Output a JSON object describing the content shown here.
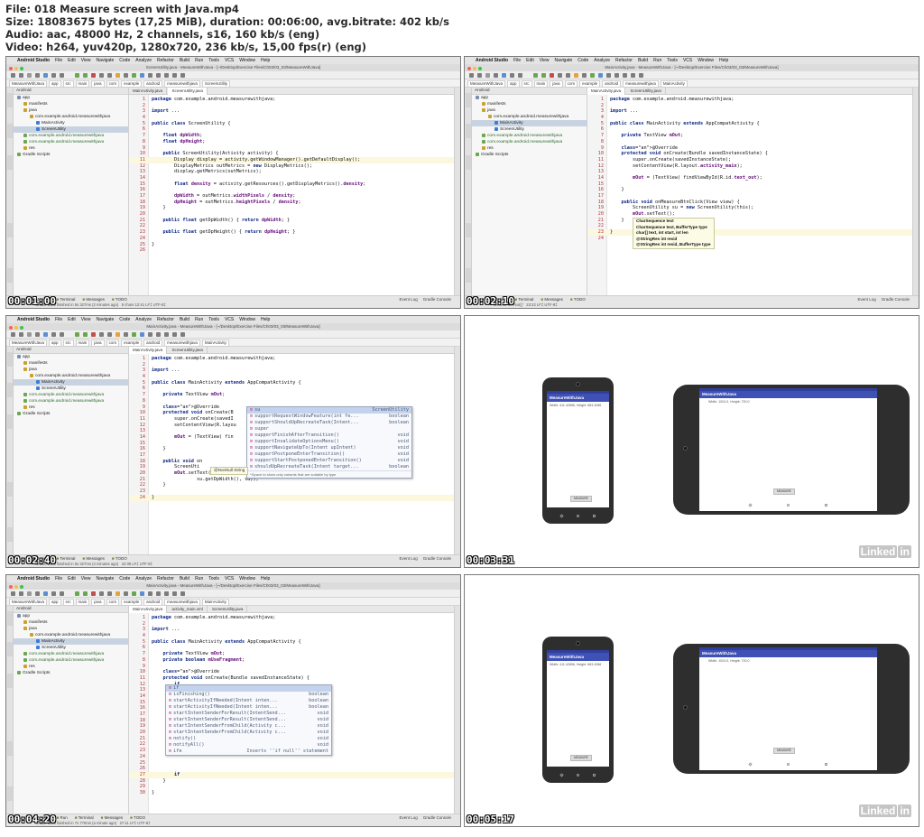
{
  "file_info": {
    "line1": "File: 018 Measure screen with Java.mp4",
    "line2": "Size: 18083675 bytes (17,25 MiB), duration: 00:06:00, avg.bitrate: 402 kb/s",
    "line3": "Audio: aac, 48000 Hz, 2 channels, s16, 160 kb/s (eng)",
    "line4": "Video: h264, yuv420p, 1280x720, 236 kb/s, 15,00 fps(r) (eng)"
  },
  "ide": {
    "app_name": "Android Studio",
    "menu": [
      "File",
      "Edit",
      "View",
      "Navigate",
      "Code",
      "Analyze",
      "Refactor",
      "Build",
      "Run",
      "Tools",
      "VCS",
      "Window",
      "Help"
    ],
    "project_label": "Android",
    "nav_crumbs": [
      "MeasureWithJava",
      "app",
      "src",
      "main",
      "java",
      "com",
      "example",
      "android",
      "measurewithjava"
    ],
    "tree": [
      "app",
      "manifests",
      "java",
      "com.example.android.measurewithjava",
      "MainActivity",
      "ScreenUtility",
      "com.example.android.measurewithjava",
      "com.example.android.measurewithjava",
      "res",
      "Gradle Scripts"
    ],
    "bottom_tools": [
      "Android Monitor",
      "Terminal",
      "Messages",
      "TODO"
    ],
    "bottom_tools_run": [
      "Android Monitor",
      "Run",
      "Terminal",
      "Messages",
      "TODO"
    ],
    "event_log": "Event Log",
    "gradle_console": "Gradle Console",
    "tab_main": "MainActivity.java",
    "tab_screen": "ScreenUtility.java",
    "tab_layout": "activity_main.xml"
  },
  "thumbs": [
    {
      "timestamp": "00:01:00",
      "title": "ScreenUtility.java - MeasureWithJava - [~/Desktop/Exercise Files/Ch03/03_03/MeasureWithJava]",
      "crumb": "ScreenUtility",
      "status": "8 chars   12:41  LF‡  UTF-8‡",
      "msg": "Gradle build finished in 5s 327ms (2 minutes ago)"
    },
    {
      "timestamp": "00:02:10",
      "title": "MainActivity.java - MeasureWithJava - [~/Desktop/Exercise Files/Ch03/03_03/MeasureWithJava]",
      "crumb": "MainActivity",
      "status": "23:22  LF‡  UTF-8‡",
      "msg": "Method 'setText()'"
    },
    {
      "timestamp": "00:02:40",
      "title": "MainActivity.java - MeasureWithJava - [~/Desktop/Exercise Files/Ch03/03_03/MeasureWithJava]",
      "crumb": "MainActivity",
      "status": "24:36  LF‡  UTF-8‡",
      "msg": "Gradle build finished in 5s 327ms (4 minutes ago)"
    },
    {
      "timestamp": "00:03:31"
    },
    {
      "timestamp": "00:04:20",
      "title": "MainActivity.java - MeasureWithJava - [~/Desktop/Exercise Files/Ch03/03_03/MeasureWithJava]",
      "crumb": "MainActivity",
      "status": "27:11  LF‡  UTF-8‡",
      "msg": "Gradle build finished in 7s 776ms (a minute ago)"
    },
    {
      "timestamp": "00:05:17"
    }
  ],
  "code1": [
    "package com.example.android.measurewithjava;",
    "",
    "import ...",
    "",
    "public class ScreenUtility {",
    "",
    "    float dpWidth;",
    "    float dpHeight;",
    "",
    "    public ScreenUtility(Activity activity) {",
    "        Display display = activity.getWindowManager().getDefaultDisplay();",
    "        DisplayMetrics outMetrics = new DisplayMetrics();",
    "        display.getMetrics(outMetrics);",
    "",
    "        float density = activity.getResources().getDisplayMetrics().density;",
    "",
    "        dpWidth = outMetrics.widthPixels / density;",
    "        dpHeight = outMetrics.heightPixels / density;",
    "    }",
    "",
    "    public float getDpWidth() { return dpWidth; }",
    "",
    "    public float getDpHeight() { return dpHeight; }",
    "",
    "}",
    ""
  ],
  "code2": [
    "package com.example.android.measurewithjava;",
    "",
    "import ...",
    "",
    "public class MainActivity extends AppCompatActivity {",
    "",
    "    private TextView mOut;",
    "",
    "    @Override",
    "    protected void onCreate(Bundle savedInstanceState) {",
    "        super.onCreate(savedInstanceState);",
    "        setContentView(R.layout.activity_main);",
    "",
    "        mOut = (TextView) findViewById(R.id.text_out);",
    "",
    "    }",
    "",
    "    public void onMeasureBtnClick(View view) {",
    "        ScreenUtility su = new ScreenUtility(this);",
    "        mOut.setText();",
    "    }",
    "",
    "}",
    ""
  ],
  "code3": [
    "package com.example.android.measurewithjava;",
    "",
    "import ...",
    "",
    "public class MainActivity extends AppCompatActivity {",
    "",
    "    private TextView mOut;",
    "",
    "    @Override",
    "    protected void onCreate(B",
    "        super.onCreate(savedI",
    "        setContentView(R.layou",
    "",
    "        mOut = (TextView) fin",
    "",
    "    }",
    "",
    "    public void on",
    "        ScreenUti",
    "        mOut.setText(\"Width: \"",
    "                su.getDpWidth(), su));",
    "    }",
    "",
    "}"
  ],
  "code4": [
    "package com.example.android.measurewithjava;",
    "",
    "import ...",
    "",
    "public class MainActivity extends AppCompatActivity {",
    "",
    "    private TextView mOut;",
    "    private boolean mUseFragment;",
    "",
    "    @Override",
    "    protected void onCreate(Bundle savedInstanceState) {",
    "        if",
    "",
    "",
    "",
    "",
    "",
    "",
    "",
    "",
    "                                                     %s\",",
    "",
    "",
    "",
    "",
    "",
    "        if",
    "    }",
    "",
    "}"
  ],
  "hint2": [
    "CharSequence text",
    "CharSequence text, BufferType type",
    "char[] text, int start, int len",
    "@StringRes int resid",
    "@StringRes int resid, BufferType type"
  ],
  "popup3": {
    "rows": [
      {
        "name": "su",
        "type": "ScreenUtility"
      },
      {
        "name": "supportRequestWindowFeature(int fe...",
        "type": "boolean"
      },
      {
        "name": "supportShouldUpRecreateTask(Intent...",
        "type": "boolean"
      },
      {
        "name": "super",
        "type": ""
      },
      {
        "name": "supportFinishAfterTransition()",
        "type": "void"
      },
      {
        "name": "supportInvalidateOptionsMenu()",
        "type": "void"
      },
      {
        "name": "supportNavigateUpTo(Intent upIntent)",
        "type": "void"
      },
      {
        "name": "supportPostponeEnterTransition()",
        "type": "void"
      },
      {
        "name": "supportStartPostponedEnterTransition()",
        "type": "void"
      },
      {
        "name": "shouldUpRecreateTask(Intent target...",
        "type": "boolean"
      }
    ],
    "foot": "^Space to show only variants that are suitable by type",
    "note": "@NonNull String"
  },
  "popup4": {
    "rows": [
      {
        "name": "if",
        "type": ""
      },
      {
        "name": "isFinishing()",
        "type": "boolean"
      },
      {
        "name": "startActivityIfNeeded(Intent inten...",
        "type": "boolean"
      },
      {
        "name": "startActivityIfNeeded(Intent inten...",
        "type": "boolean"
      },
      {
        "name": "startIntentSenderForResult(IntentSend...",
        "type": "void"
      },
      {
        "name": "startIntentSenderForResult(IntentSend...",
        "type": "void"
      },
      {
        "name": "startIntentSenderFromChild(Activity c...",
        "type": "void"
      },
      {
        "name": "startIntentSenderFromChild(Activity c...",
        "type": "void"
      },
      {
        "name": "notify()",
        "type": "void"
      },
      {
        "name": "notifyAll()",
        "type": "void"
      },
      {
        "name": "ife",
        "type": "Inserts ''if null'' statement"
      }
    ]
  },
  "emulator": {
    "app_title": "MeasureWithJava",
    "portrait_text": "Width: 411.42856, Height: 683.4286",
    "landscape_text": "Width: 1024.0, Height: 720.0",
    "button_label": "MEASURE"
  },
  "watermark": "Linked",
  "watermark_in": "in",
  "colors": {
    "android_blue": "#3f51b5",
    "keyword": "#102a86",
    "line_number": "#b5373c"
  }
}
